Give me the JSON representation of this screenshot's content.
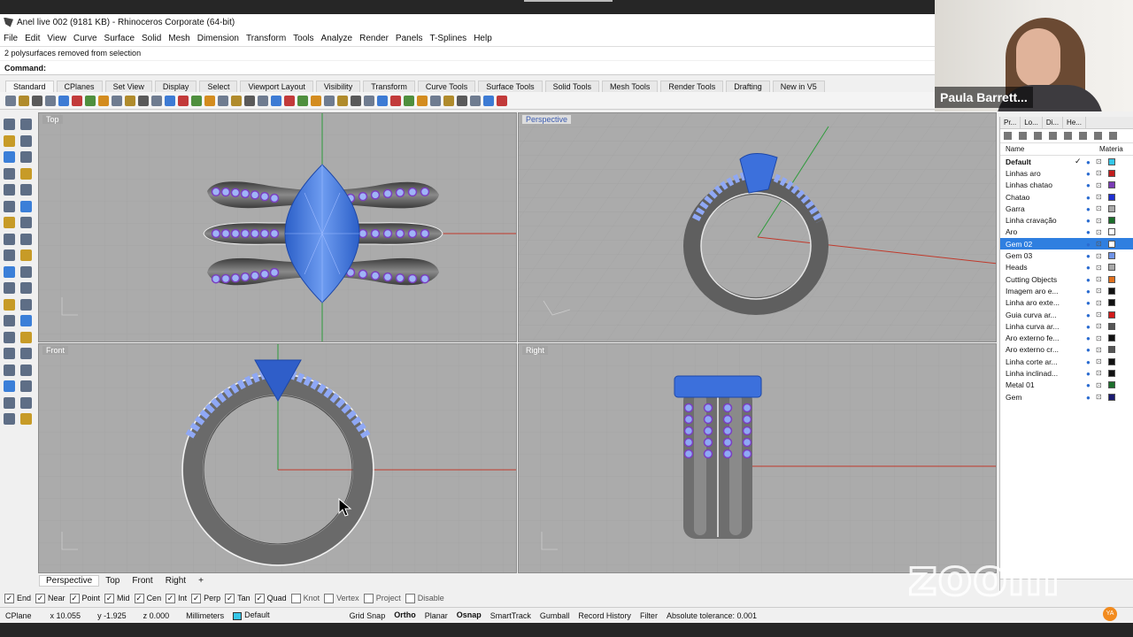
{
  "window": {
    "title": "Anel live 002 (9181 KB) - Rhinoceros Corporate (64-bit)"
  },
  "menu": [
    "File",
    "Edit",
    "View",
    "Curve",
    "Surface",
    "Solid",
    "Mesh",
    "Dimension",
    "Transform",
    "Tools",
    "Analyze",
    "Render",
    "Panels",
    "T-Splines",
    "Help"
  ],
  "command": {
    "history": "2 polysurfaces removed from selection",
    "prompt": "Command:"
  },
  "toolbar_tabs": [
    "Standard",
    "CPlanes",
    "Set View",
    "Display",
    "Select",
    "Viewport Layout",
    "Visibility",
    "Transform",
    "Curve Tools",
    "Surface Tools",
    "Solid Tools",
    "Mesh Tools",
    "Render Tools",
    "Drafting",
    "New in V5"
  ],
  "viewports": {
    "top": "Top",
    "perspective": "Perspective",
    "front": "Front",
    "right": "Right"
  },
  "viewport_tabs": [
    "Perspective",
    "Top",
    "Front",
    "Right",
    "+"
  ],
  "osnap": [
    {
      "label": "End",
      "checked": true
    },
    {
      "label": "Near",
      "checked": true
    },
    {
      "label": "Point",
      "checked": true
    },
    {
      "label": "Mid",
      "checked": true
    },
    {
      "label": "Cen",
      "checked": true
    },
    {
      "label": "Int",
      "checked": true
    },
    {
      "label": "Perp",
      "checked": true
    },
    {
      "label": "Tan",
      "checked": true
    },
    {
      "label": "Quad",
      "checked": true
    },
    {
      "label": "Knot",
      "checked": false
    },
    {
      "label": "Vertex",
      "checked": false
    },
    {
      "label": "Project",
      "checked": false
    },
    {
      "label": "Disable",
      "checked": false
    }
  ],
  "status": {
    "cplane": "CPlane",
    "x": "x 10.055",
    "y": "y -1.925",
    "z": "z 0.000",
    "units": "Millimeters",
    "layer": "Default",
    "grid_snap": "Grid Snap",
    "ortho": "Ortho",
    "planar": "Planar",
    "osnap": "Osnap",
    "smarttrack": "SmartTrack",
    "gumball": "Gumball",
    "record": "Record History",
    "filter": "Filter",
    "tolerance": "Absolute tolerance: 0.001"
  },
  "panel": {
    "tabs": [
      "Pr...",
      "Lo...",
      "Di...",
      "He..."
    ],
    "col_name": "Name",
    "col_material": "Materia",
    "layers": [
      {
        "name": "Default",
        "bold": true,
        "current": true,
        "color": "#35c6e8"
      },
      {
        "name": "Linhas aro",
        "color": "#c21d1d"
      },
      {
        "name": "Linhas chatao",
        "color": "#7a3bb5"
      },
      {
        "name": "Chatao",
        "color": "#1f2fd0"
      },
      {
        "name": "Garra",
        "color": "#a8a8a8"
      },
      {
        "name": "Linha cravação",
        "color": "#1c6e2b"
      },
      {
        "name": "Aro",
        "color": "#ffffff"
      },
      {
        "name": "Gem 02",
        "color": "#ffffff",
        "selected": true
      },
      {
        "name": "Gem 03",
        "color": "#6f93e6"
      },
      {
        "name": "Heads",
        "color": "#a8a8a8"
      },
      {
        "name": "Cutting Objects",
        "color": "#e0701c"
      },
      {
        "name": "Imagem aro e...",
        "color": "#111111"
      },
      {
        "name": "Linha aro exte...",
        "color": "#111111"
      },
      {
        "name": "Guia curva ar...",
        "color": "#d11919"
      },
      {
        "name": "Linha curva ar...",
        "color": "#555555"
      },
      {
        "name": "Aro externo fe...",
        "color": "#111111"
      },
      {
        "name": "Aro externo cr...",
        "color": "#555555"
      },
      {
        "name": "Linha corte ar...",
        "color": "#111111"
      },
      {
        "name": "Linha inclinad...",
        "color": "#111111"
      },
      {
        "name": "Metal 01",
        "color": "#1c6e2b"
      },
      {
        "name": "Gem",
        "color": "#1a1a70"
      }
    ]
  },
  "webcam": {
    "name": "Paula Barrett..."
  },
  "zoom_logo": "zoom",
  "colors": {
    "viewport_bg": "#ababab",
    "grid": "#9e9e9e",
    "metal": "#6e6e6e",
    "gem": "#4a7fe0",
    "pave": "#8fa8f5",
    "x_axis": "#c0392b",
    "y_axis": "#2e9b3b"
  }
}
